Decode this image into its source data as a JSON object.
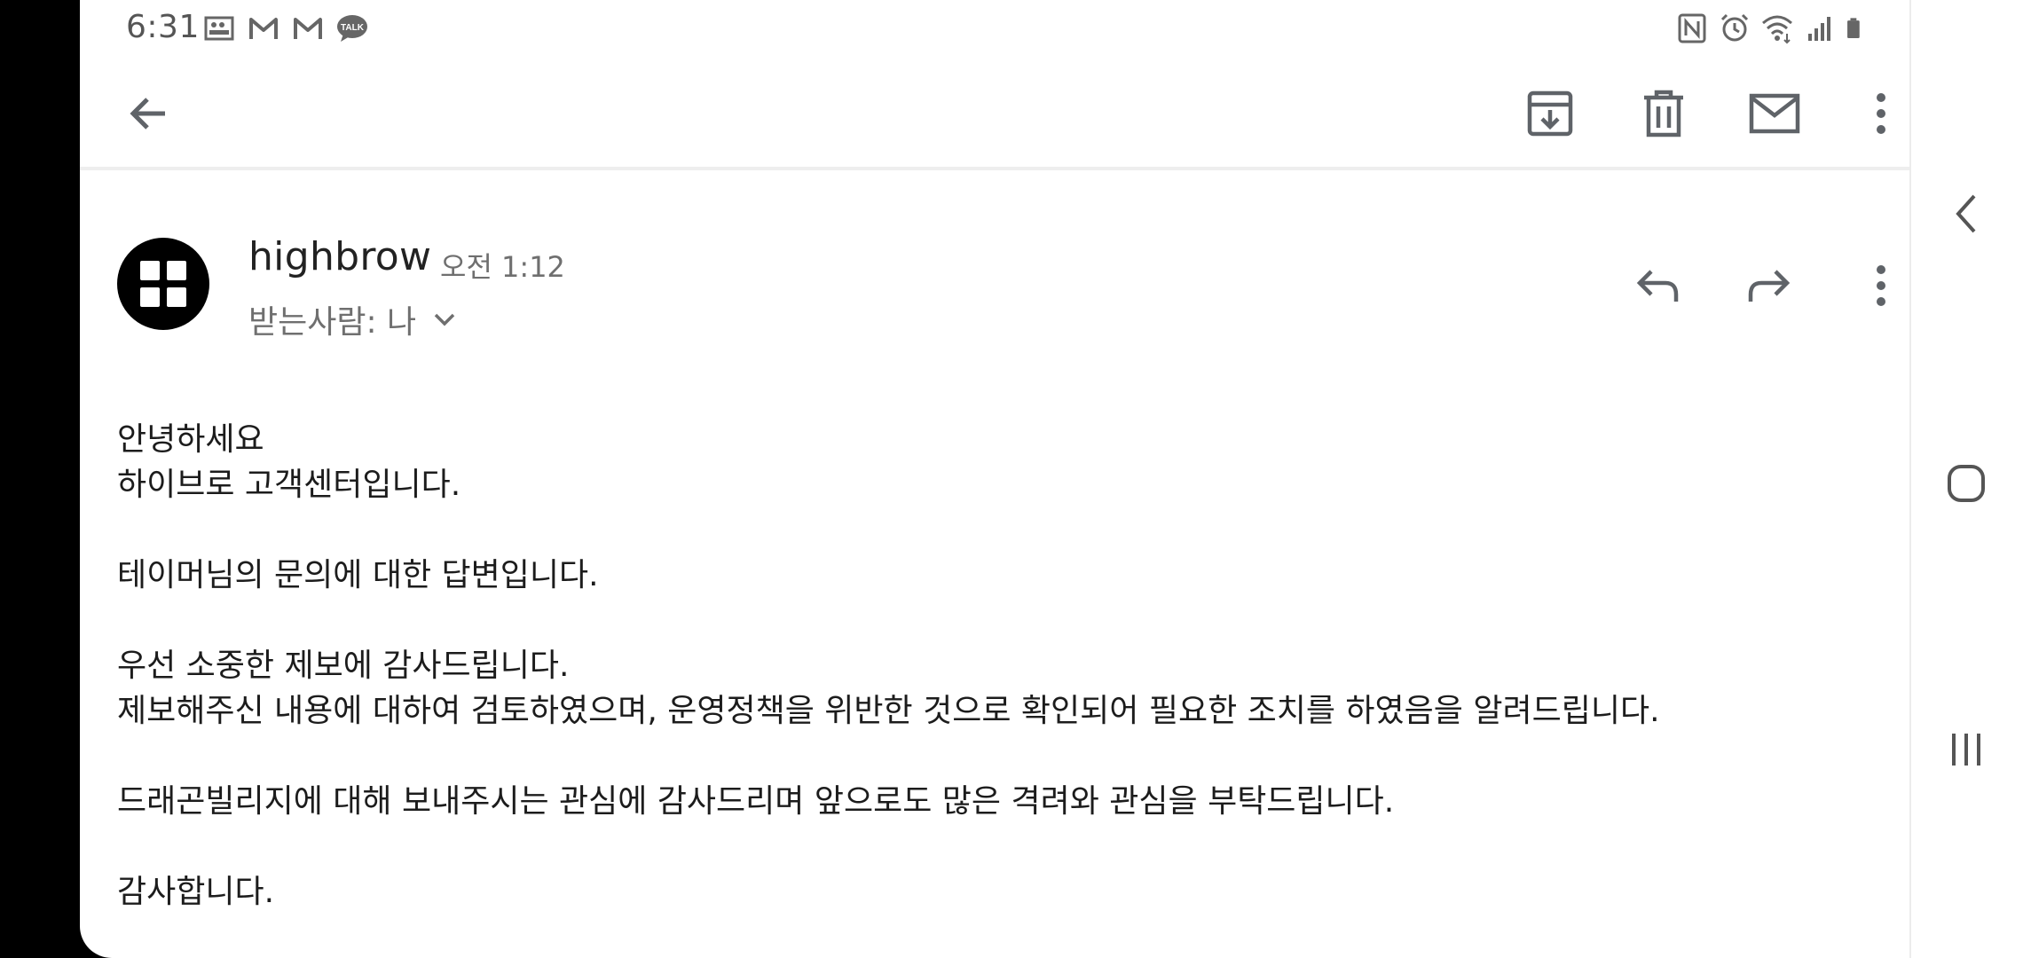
{
  "status_bar": {
    "time": "6:31",
    "left_icons": [
      "gallery-icon",
      "gmail-icon",
      "gmail-icon",
      "kakaotalk-icon"
    ],
    "kakaotalk_label": "TALK",
    "right_icons": [
      "nfc-icon",
      "alarm-icon",
      "wifi-icon",
      "signal-icon",
      "battery-icon"
    ]
  },
  "toolbar": {
    "back": "back-arrow-icon",
    "actions": [
      "archive-icon",
      "delete-icon",
      "mark-unread-icon",
      "more-vert-icon"
    ]
  },
  "email": {
    "sender": "highbrow",
    "time": "오전 1:12",
    "recipient_label": "받는사람: 나",
    "body_lines": [
      "안녕하세요",
      "하이브로 고객센터입니다.",
      "",
      "테이머님의 문의에 대한 답변입니다.",
      "",
      "우선 소중한 제보에 감사드립니다.",
      "제보해주신 내용에 대하여 검토하였으며, 운영정책을 위반한 것으로 확인되어 필요한 조치를 하였음을 알려드립니다.",
      "",
      "드래곤빌리지에 대해 보내주시는 관심에 감사드리며 앞으로도 많은 격려와 관심을 부탁드립니다.",
      "",
      "감사합니다."
    ]
  },
  "colors": {
    "icon": "#5f6368",
    "text": "#1c1c1c",
    "secondary_text": "#6f6f6f",
    "background": "#ffffff",
    "frame": "#000000"
  }
}
